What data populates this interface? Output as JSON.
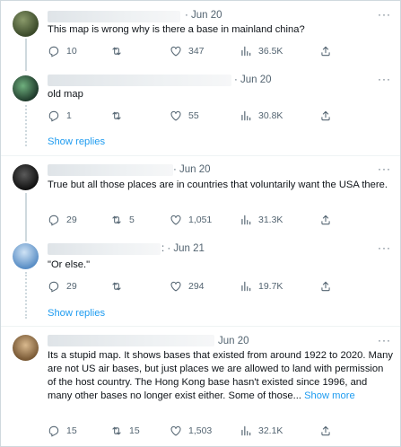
{
  "tweets": [
    {
      "date": "· Jun 20",
      "text": "This map is wrong why is there a base in mainland china?",
      "replies": "10",
      "retweets": "",
      "likes": "347",
      "views": "36.5K"
    },
    {
      "date": "· Jun 20",
      "text": "old map",
      "replies": "1",
      "retweets": "",
      "likes": "55",
      "views": "30.8K",
      "show_replies": "Show replies"
    },
    {
      "date": "· Jun 20",
      "text": "True but all those places are in countries that voluntarily want the USA there.",
      "replies": "29",
      "retweets": "5",
      "likes": "1,051",
      "views": "31.3K"
    },
    {
      "date": ": · Jun 21",
      "text": "\"Or else.\"",
      "replies": "29",
      "retweets": "",
      "likes": "294",
      "views": "19.7K",
      "show_replies": "Show replies"
    },
    {
      "date": "Jun 20",
      "text": "Its a stupid map. It shows bases that existed from around 1922 to 2020. Many are not US air bases, but just places we are allowed to land with permission of the host country. The Hong Kong base hasn't existed since 1996, and many other bases no longer exist either. Some of those...",
      "show_more": "Show more",
      "replies": "15",
      "retweets": "15",
      "likes": "1,503",
      "views": "32.1K"
    }
  ],
  "more_glyph": "···",
  "icons": {
    "reply": "reply-icon",
    "retweet": "retweet-icon",
    "like": "like-icon",
    "views": "views-icon",
    "share": "share-icon"
  },
  "colors": {
    "link": "#1d9bf0",
    "muted": "#536471",
    "border": "#cfd9de"
  }
}
